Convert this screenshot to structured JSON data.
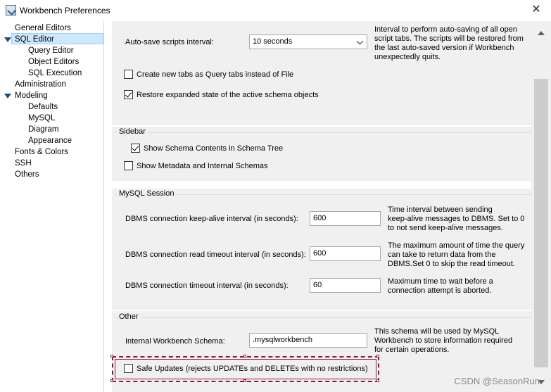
{
  "window": {
    "title": "Workbench Preferences",
    "close_glyph": "✕"
  },
  "sidebar": {
    "items": [
      {
        "label": "General Editors"
      },
      {
        "label": "SQL Editor"
      },
      {
        "label": "Query Editor"
      },
      {
        "label": "Object Editors"
      },
      {
        "label": "SQL Execution"
      },
      {
        "label": "Administration"
      },
      {
        "label": "Modeling"
      },
      {
        "label": "Defaults"
      },
      {
        "label": "MySQL"
      },
      {
        "label": "Diagram"
      },
      {
        "label": "Appearance"
      },
      {
        "label": "Fonts & Colors"
      },
      {
        "label": "SSH"
      },
      {
        "label": "Others"
      }
    ],
    "selected": "SQL Editor"
  },
  "top_section": {
    "autosave_label": "Auto-save scripts interval:",
    "autosave_value": "10 seconds",
    "autosave_help": [
      "Interval to perform auto-saving of all open",
      "script tabs. The scripts will be restored from",
      "the last auto-saved version if Workbench",
      "unexpectedly quits."
    ],
    "new_tabs_label": "Create new tabs as Query tabs instead of File",
    "new_tabs_checked": false,
    "restore_state_label": "Restore expanded state of the active schema objects",
    "restore_state_checked": true
  },
  "sidebar_group": {
    "title": "Sidebar",
    "show_schema_label": "Show Schema Contents in Schema Tree",
    "show_schema_checked": true,
    "show_metadata_label": "Show Metadata and Internal Schemas",
    "show_metadata_checked": false
  },
  "mysql_session": {
    "title": "MySQL Session",
    "keepalive_label": "DBMS connection keep-alive interval (in seconds):",
    "keepalive_value": "600",
    "keepalive_help": [
      "Time interval between sending",
      "keep-alive messages to DBMS. Set to 0",
      "to not send keep-alive messages."
    ],
    "read_timeout_label": "DBMS connection read timeout interval (in seconds):",
    "read_timeout_value": "600",
    "read_timeout_help": [
      "The maximum amount of time the query",
      "can take to return data from the",
      "DBMS.Set 0 to skip the read timeout."
    ],
    "conn_timeout_label": "DBMS connection timeout interval (in seconds):",
    "conn_timeout_value": "60",
    "conn_timeout_help": [
      "Maximum time to wait before a",
      "connection attempt is aborted."
    ]
  },
  "other_group": {
    "title": "Other",
    "schema_label": "Internal Workbench Schema:",
    "schema_value": ".mysqlworkbench",
    "schema_help": [
      "This schema will be used by MySQL",
      "Workbench to store information required",
      "for certain operations."
    ],
    "safe_updates_label": "Safe Updates (rejects UPDATEs and DELETEs with no restrictions)",
    "safe_updates_checked": false
  },
  "watermark": "CSDN @SeasonRun"
}
